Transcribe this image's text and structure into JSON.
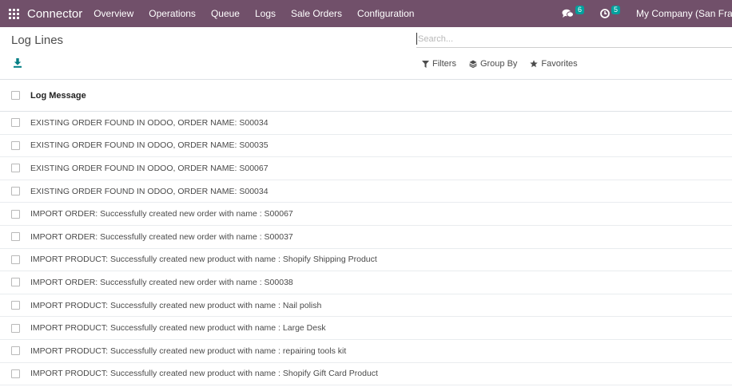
{
  "navbar": {
    "brand": "Connector",
    "menu": [
      "Overview",
      "Operations",
      "Queue",
      "Logs",
      "Sale Orders",
      "Configuration"
    ],
    "messages_count": "6",
    "activities_count": "5",
    "company": "My Company (San Francisco)"
  },
  "control_panel": {
    "title": "Log Lines",
    "search_placeholder": "Search...",
    "filters_label": "Filters",
    "group_by_label": "Group By",
    "favorites_label": "Favorites"
  },
  "list": {
    "column_header": "Log Message",
    "rows": [
      "EXISTING ORDER FOUND IN ODOO, ORDER NAME: S00034",
      "EXISTING ORDER FOUND IN ODOO, ORDER NAME: S00035",
      "EXISTING ORDER FOUND IN ODOO, ORDER NAME: S00067",
      "EXISTING ORDER FOUND IN ODOO, ORDER NAME: S00034",
      "IMPORT ORDER: Successfully created new order with name : S00067",
      "IMPORT ORDER: Successfully created new order with name : S00037",
      "IMPORT PRODUCT: Successfully created new product with name : Shopify Shipping Product",
      "IMPORT ORDER: Successfully created new order with name : S00038",
      "IMPORT PRODUCT: Successfully created new product with name : Nail polish",
      "IMPORT PRODUCT: Successfully created new product with name : Large Desk",
      "IMPORT PRODUCT: Successfully created new product with name : repairing tools kit",
      "IMPORT PRODUCT: Successfully created new product with name : Shopify Gift Card Product"
    ]
  },
  "colors": {
    "navbar_bg": "#71506a",
    "badge_bg": "#00a09d",
    "download_icon": "#017e84"
  },
  "icons": {
    "apps": "apps-grid-icon",
    "messages": "chat-bubbles-icon",
    "activities": "clock-icon",
    "download": "download-icon",
    "filters": "funnel-icon",
    "group_by": "layers-icon",
    "favorites": "star-icon"
  }
}
